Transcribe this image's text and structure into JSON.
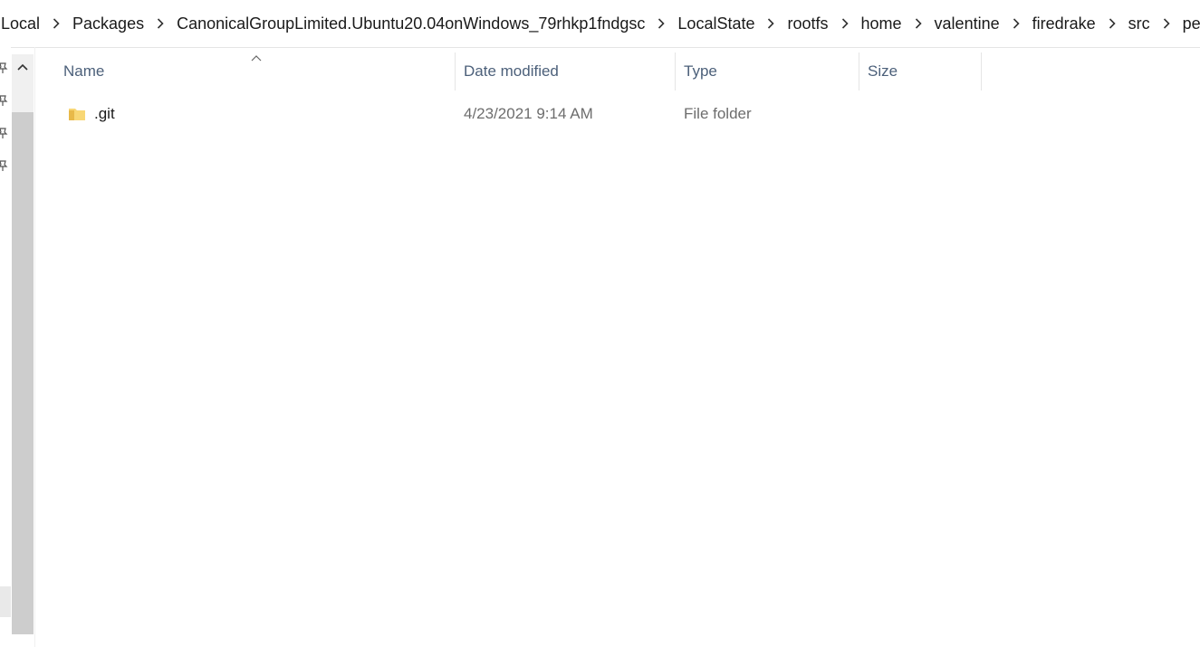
{
  "breadcrumb": {
    "items": [
      "Local",
      "Packages",
      "CanonicalGroupLimited.Ubuntu20.04onWindows_79rhkp1fndgsc",
      "LocalState",
      "rootfs",
      "home",
      "valentine",
      "firedrake",
      "src",
      "petsc"
    ],
    "separator_icon": "chevron-right-icon"
  },
  "columns": {
    "name": "Name",
    "date_modified": "Date modified",
    "type": "Type",
    "size": "Size",
    "sort_icon": "sort-ascending-icon"
  },
  "files": [
    {
      "name": ".git",
      "date_modified": "4/23/2021 9:14 AM",
      "type": "File folder",
      "size": "",
      "icon": "folder-icon"
    }
  ],
  "nav": {
    "pin_icons": [
      "pin-icon",
      "pin-icon",
      "pin-icon",
      "pin-icon"
    ],
    "scroll_up_icon": "chevron-up-icon"
  },
  "colors": {
    "header_text": "#4c607a",
    "folder": "#f8d775",
    "secondary_text": "#6d6d6d"
  }
}
